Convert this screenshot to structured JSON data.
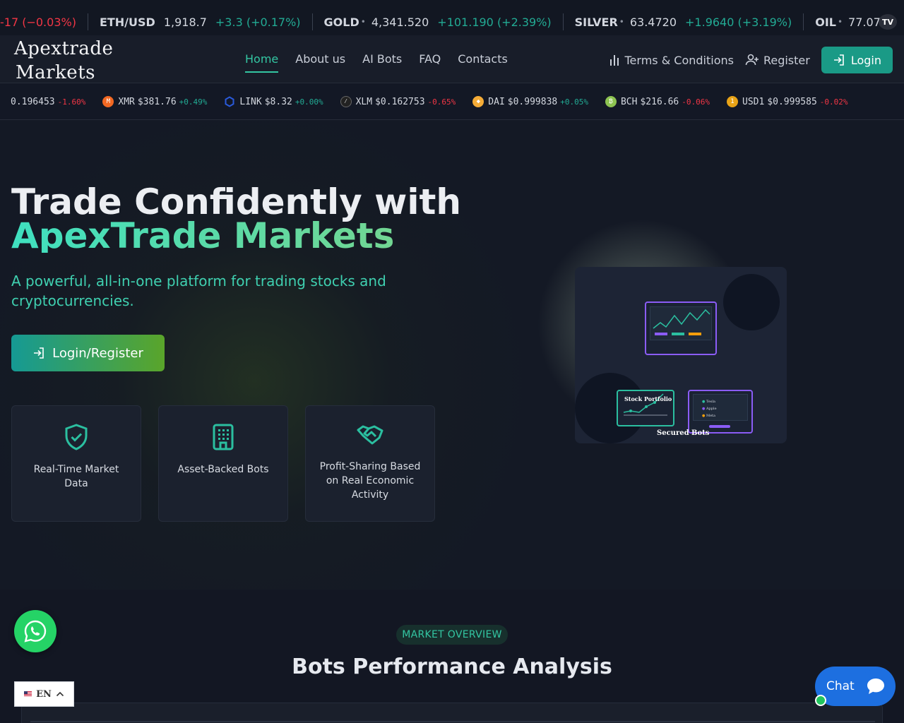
{
  "ticker_top": {
    "items": [
      {
        "symbol": "",
        "price": "",
        "change": "-17 (−0.03%)",
        "direction": "down",
        "dot": false
      },
      {
        "symbol": "ETH/USD",
        "price": "1,918.7",
        "change": "+3.3 (+0.17%)",
        "direction": "up",
        "dot": false
      },
      {
        "symbol": "GOLD",
        "price": "4,341.520",
        "change": "+101.190 (+2.39%)",
        "direction": "up",
        "dot": true
      },
      {
        "symbol": "SILVER",
        "price": "63.4720",
        "change": "+1.9640 (+3.19%)",
        "direction": "up",
        "dot": true
      },
      {
        "symbol": "OIL",
        "price": "77.07",
        "change": "",
        "direction": "up",
        "dot": true
      }
    ],
    "badge": "TV"
  },
  "header": {
    "logo_line1": "Apextrade",
    "logo_line2": "Markets",
    "nav": [
      {
        "label": "Home",
        "active": true
      },
      {
        "label": "About us",
        "active": false
      },
      {
        "label": "AI Bots",
        "active": false
      },
      {
        "label": "FAQ",
        "active": false
      },
      {
        "label": "Contacts",
        "active": false
      }
    ],
    "terms_label": "Terms & Conditions",
    "register_label": "Register",
    "login_label": "Login"
  },
  "ticker_crypto": {
    "items": [
      {
        "symbol": "",
        "price": "0.196453",
        "change": "-1.60%",
        "direction": "down",
        "coin_color": ""
      },
      {
        "symbol": "XMR",
        "price": "$381.76",
        "change": "+0.49%",
        "direction": "up",
        "coin_color": "#f26822"
      },
      {
        "symbol": "LINK",
        "price": "$8.32",
        "change": "+0.00%",
        "direction": "up",
        "coin_color": "#2a5ada"
      },
      {
        "symbol": "XLM",
        "price": "$0.162753",
        "change": "-0.65%",
        "direction": "down",
        "coin_color": "#222222"
      },
      {
        "symbol": "DAI",
        "price": "$0.999838",
        "change": "+0.05%",
        "direction": "up",
        "coin_color": "#f5ac37"
      },
      {
        "symbol": "BCH",
        "price": "$216.66",
        "change": "-0.06%",
        "direction": "down",
        "coin_color": "#8dc351"
      },
      {
        "symbol": "USD1",
        "price": "$0.999585",
        "change": "-0.02%",
        "direction": "down",
        "coin_color": "#e8a317"
      }
    ]
  },
  "hero": {
    "title_line1": "Trade Confidently with",
    "title_line2": "ApexTrade Markets",
    "subtitle": "A powerful, all-in-one platform for trading stocks and cryptocurrencies.",
    "cta_label": "Login/Register",
    "features": [
      {
        "icon": "shield-check-icon",
        "text": "Real-Time Market Data"
      },
      {
        "icon": "building-icon",
        "text": "Asset-Backed Bots"
      },
      {
        "icon": "handshake-icon",
        "text": "Profit-Sharing Based on Real Economic Activity"
      }
    ],
    "illustration": {
      "card1_label": "Stock Portfolio",
      "card2_label": "Secured Bots",
      "list": [
        "Tesla",
        "Apple",
        "Meta"
      ]
    }
  },
  "market": {
    "pill": "MARKET OVERVIEW",
    "title": "Bots Performance Analysis"
  },
  "widgets": {
    "lang": "EN",
    "chat": "Chat"
  },
  "colors": {
    "accent": "#33c6a2",
    "up": "#22ab94",
    "down": "#f23645",
    "bg": "#131825"
  }
}
